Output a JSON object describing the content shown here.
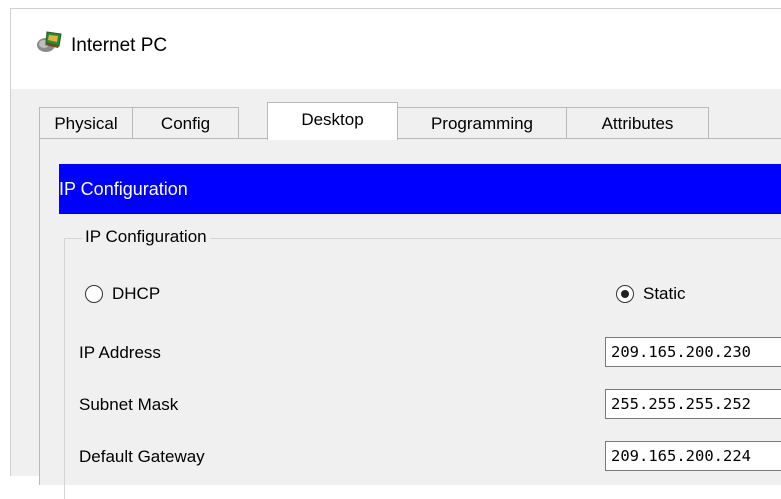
{
  "window": {
    "title": "Internet PC",
    "icon": "pc-icon"
  },
  "tabs": [
    {
      "label": "Physical",
      "active": false
    },
    {
      "label": "Config",
      "active": false
    },
    {
      "label": "Desktop",
      "active": true
    },
    {
      "label": "Programming",
      "active": false
    },
    {
      "label": "Attributes",
      "active": false
    }
  ],
  "header": {
    "title": "IP Configuration",
    "color": "#0000ff"
  },
  "ip_config": {
    "group_label": "IP Configuration",
    "mode_dhcp_label": "DHCP",
    "mode_static_label": "Static",
    "selected_mode": "Static",
    "ip_address_label": "IP Address",
    "ip_address_value": "209.165.200.230",
    "subnet_mask_label": "Subnet Mask",
    "subnet_mask_value": "255.255.255.252",
    "default_gateway_label": "Default Gateway",
    "default_gateway_value": "209.165.200.224"
  }
}
